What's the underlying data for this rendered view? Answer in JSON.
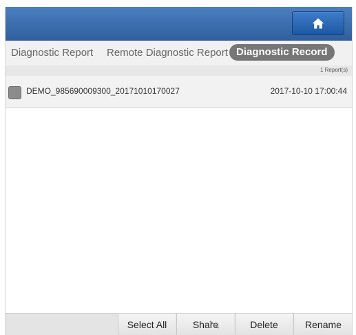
{
  "tabs": [
    {
      "label": "Diagnostic Report"
    },
    {
      "label": "Remote Diagnostic Report"
    },
    {
      "label": "Diagnostic Record"
    }
  ],
  "report_count": "1 Report(s)",
  "records": [
    {
      "name": "DEMO_985690009300_20171010170027",
      "time": "2017-10-10 17:00:44"
    }
  ],
  "actions": {
    "select_all": "Select All",
    "share": "Share",
    "delete": "Delete",
    "rename": "Rename"
  },
  "colors": {
    "topbar": "#2f5e9d",
    "active_tab": "#767676"
  },
  "icons": {
    "home": "home-icon"
  }
}
